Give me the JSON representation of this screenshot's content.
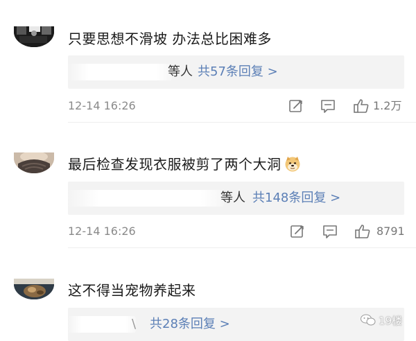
{
  "comments": [
    {
      "text": "只要思想不滑坡 办法总比困难多",
      "reply_fragment": "等人",
      "reply_link": "共57条回复 >",
      "time": "12-14 16:26",
      "likes": "1.2万"
    },
    {
      "text": "最后检查发现衣服被剪了两个大洞",
      "emoji": "doge-emoji",
      "reply_fragment": "等人",
      "reply_link": "共148条回复 >",
      "time": "12-14 16:26",
      "likes": "8791"
    },
    {
      "text": "这不得当宠物养起来",
      "reply_fragment": "\\",
      "reply_link": "共28条回复 >"
    }
  ],
  "icons": {
    "edit": "edit-icon",
    "comment": "comment-icon",
    "like": "thumbs-up-icon"
  },
  "watermark": {
    "label": "19楼"
  },
  "colors": {
    "link": "#5b7fb6",
    "meta": "#8a8a8a",
    "reply_bg": "#f3f3f3"
  }
}
